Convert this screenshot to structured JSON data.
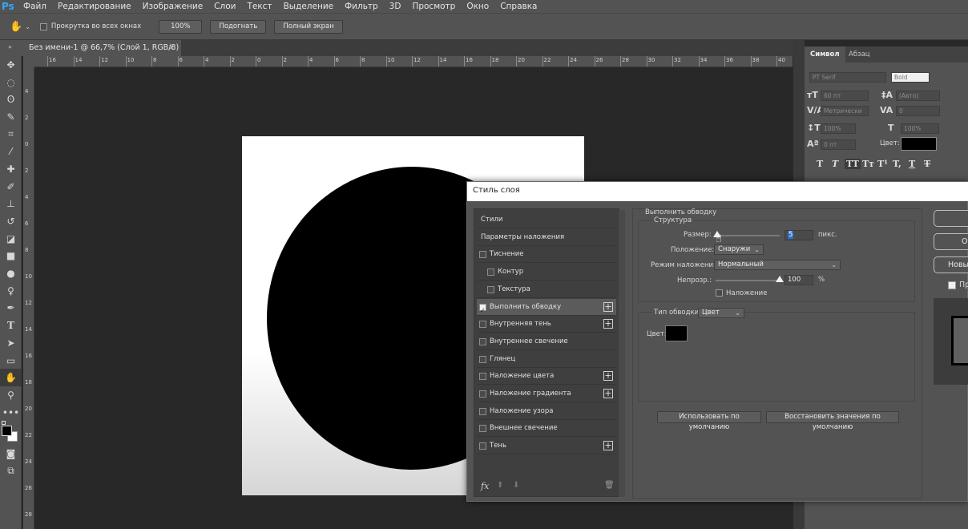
{
  "app": {
    "logo": "Ps"
  },
  "menu": [
    "Файл",
    "Редактирование",
    "Изображение",
    "Слои",
    "Текст",
    "Выделение",
    "Фильтр",
    "3D",
    "Просмотр",
    "Окно",
    "Справка"
  ],
  "options": {
    "scroll_all_windows_label": "Прокрутка во всех окнах",
    "zoom_btn": "100%",
    "fit_btn": "Подогнать",
    "fullscreen_btn": "Полный экран"
  },
  "document_tab": {
    "title": "Без имени-1 @ 66,7% (Слой 1, RGB/8) *",
    "close": "×"
  },
  "ruler": {
    "h": [
      "16",
      "14",
      "12",
      "10",
      "8",
      "6",
      "4",
      "2",
      "0",
      "2",
      "4",
      "6",
      "8",
      "10",
      "12",
      "14",
      "16",
      "18",
      "20",
      "22",
      "24",
      "26",
      "28",
      "30",
      "32",
      "34",
      "36",
      "38",
      "40"
    ],
    "v": [
      "4",
      "2",
      "0",
      "2",
      "4",
      "6",
      "8",
      "10",
      "12",
      "14",
      "16",
      "18",
      "20",
      "22",
      "24",
      "26",
      "28"
    ]
  },
  "character_panel": {
    "tabs": [
      "Символ",
      "Абзац"
    ],
    "font_family": "PT Serif",
    "font_style": "Bold",
    "font_size": "60 пт",
    "leading": "(Авто)",
    "kerning": "Метрически",
    "tracking": "0",
    "v_scale": "100%",
    "h_scale": "100%",
    "baseline": "0 пт",
    "color_label": "Цвет:"
  },
  "dialog": {
    "title": "Стиль слоя",
    "styles": [
      {
        "label": "Стили",
        "checkbox": false,
        "checked": false,
        "plus": false,
        "active": false,
        "indent": 0
      },
      {
        "label": "Параметры наложения",
        "checkbox": false,
        "checked": false,
        "plus": false,
        "active": false,
        "indent": 0
      },
      {
        "label": "Тиснение",
        "checkbox": true,
        "checked": false,
        "plus": false,
        "active": false,
        "indent": 0
      },
      {
        "label": "Контур",
        "checkbox": true,
        "checked": false,
        "plus": false,
        "active": false,
        "indent": 1
      },
      {
        "label": "Текстура",
        "checkbox": true,
        "checked": false,
        "plus": false,
        "active": false,
        "indent": 1
      },
      {
        "label": "Выполнить обводку",
        "checkbox": true,
        "checked": true,
        "plus": true,
        "active": true,
        "indent": 0
      },
      {
        "label": "Внутренняя тень",
        "checkbox": true,
        "checked": false,
        "plus": true,
        "active": false,
        "indent": 0
      },
      {
        "label": "Внутреннее свечение",
        "checkbox": true,
        "checked": false,
        "plus": false,
        "active": false,
        "indent": 0
      },
      {
        "label": "Глянец",
        "checkbox": true,
        "checked": false,
        "plus": false,
        "active": false,
        "indent": 0
      },
      {
        "label": "Наложение цвета",
        "checkbox": true,
        "checked": false,
        "plus": true,
        "active": false,
        "indent": 0
      },
      {
        "label": "Наложение градиента",
        "checkbox": true,
        "checked": false,
        "plus": true,
        "active": false,
        "indent": 0
      },
      {
        "label": "Наложение узора",
        "checkbox": true,
        "checked": false,
        "plus": false,
        "active": false,
        "indent": 0
      },
      {
        "label": "Внешнее свечение",
        "checkbox": true,
        "checked": false,
        "plus": false,
        "active": false,
        "indent": 0
      },
      {
        "label": "Тень",
        "checkbox": true,
        "checked": false,
        "plus": true,
        "active": false,
        "indent": 0
      }
    ],
    "fx_label": "fx",
    "stroke": {
      "section_title": "Выполнить обводку",
      "structure_title": "Структура",
      "size_label": "Размер:",
      "size_value": "5",
      "size_unit": "пикс.",
      "size_fraction": 0.02,
      "position_label": "Положение:",
      "position_value": "Снаружи",
      "blend_label": "Режим наложения:",
      "blend_value": "Нормальный",
      "opacity_label": "Непрозр.:",
      "opacity_value": "100",
      "opacity_unit": "%",
      "opacity_fraction": 1.0,
      "overprint_label": "Наложение",
      "fill_type_label": "Тип обводки:",
      "fill_type_value": "Цвет",
      "color_label": "Цвет:",
      "color_value": "#000000",
      "make_default_btn": "Использовать по умолчанию",
      "reset_default_btn": "Восстановить значения по умолчанию"
    },
    "side_buttons": [
      "",
      "От",
      "Новый"
    ],
    "preview_label": "Пр"
  }
}
